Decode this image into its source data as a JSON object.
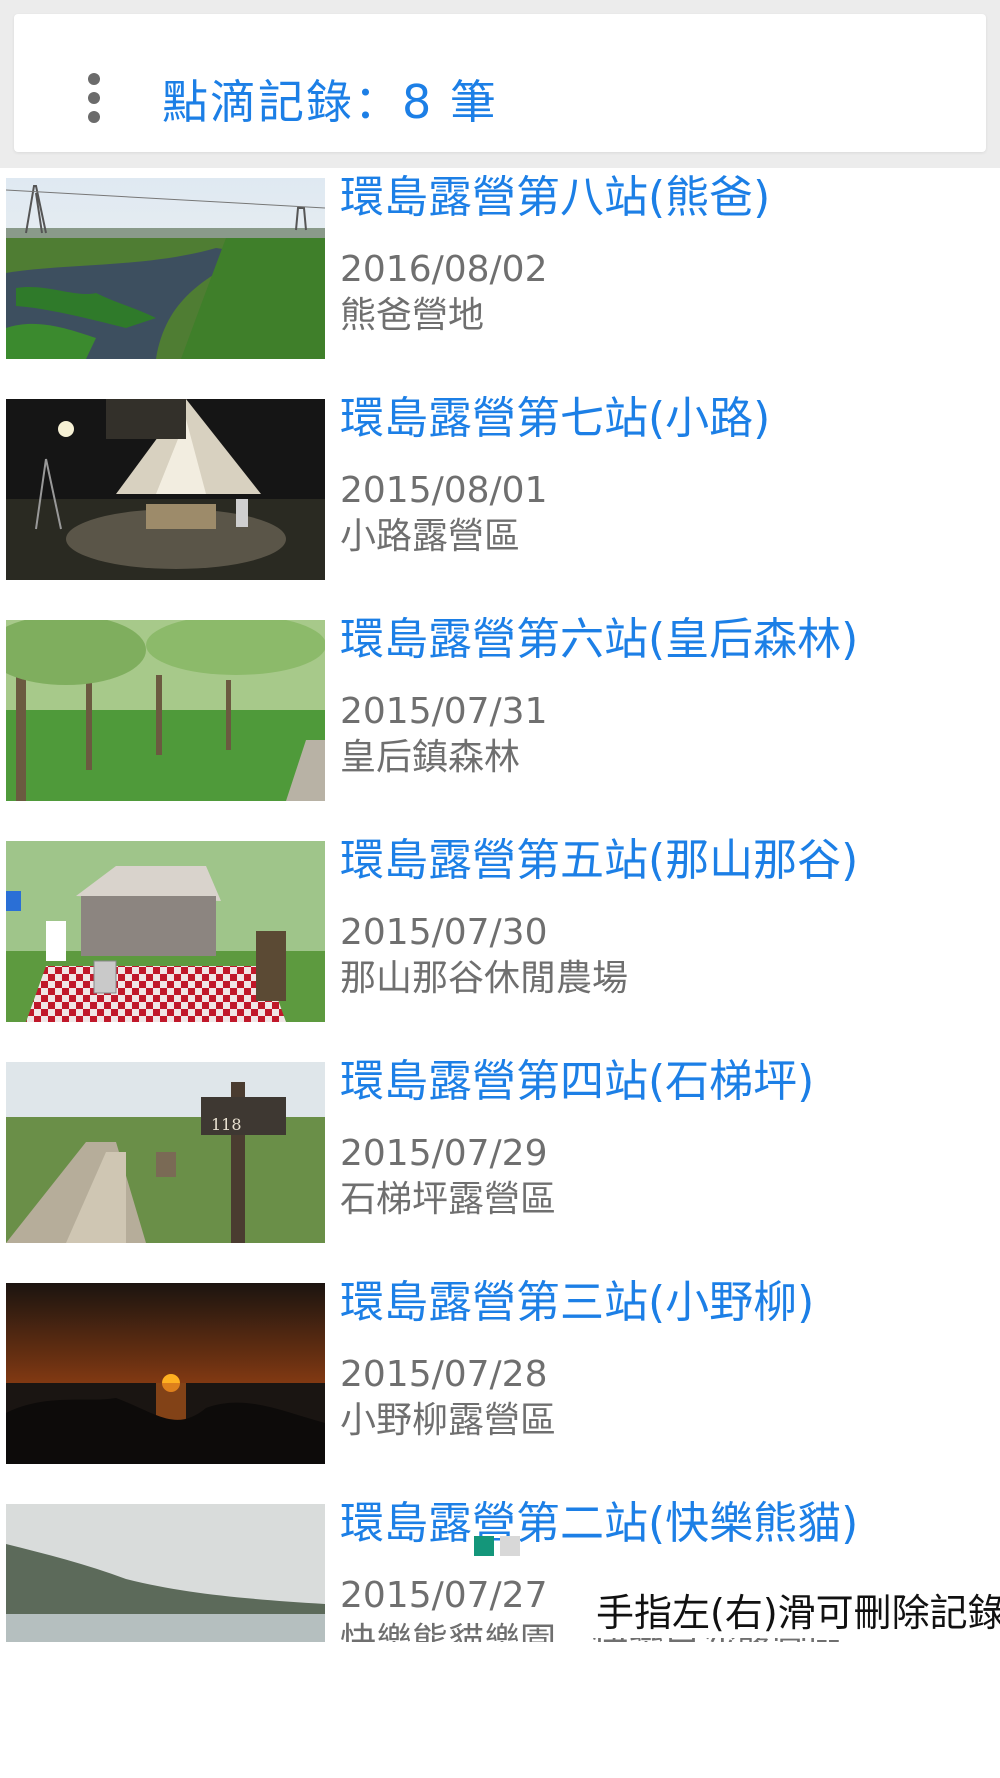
{
  "header": {
    "title": "點滴記錄：8 筆",
    "menu_icon": "more-vert-icon",
    "accent": "#1c7fe6"
  },
  "records": [
    {
      "title": "環島露營第八站(熊爸)",
      "date": "2016/08/02",
      "place": "熊爸營地"
    },
    {
      "title": "環島露營第七站(小路)",
      "date": "2015/08/01",
      "place": "小路露營區"
    },
    {
      "title": "環島露營第六站(皇后森林)",
      "date": "2015/07/31",
      "place": "皇后鎮森林"
    },
    {
      "title": "環島露營第五站(那山那谷)",
      "date": "2015/07/30",
      "place": "那山那谷休閒農場"
    },
    {
      "title": "環島露營第四站(石梯坪)",
      "date": "2015/07/29",
      "place": "石梯坪露營區"
    },
    {
      "title": "環島露營第三站(小野柳)",
      "date": "2015/07/28",
      "place": "小野柳露營區"
    },
    {
      "title": "環島露營第二站(快樂熊貓)",
      "date": "2015/07/27",
      "place": "快樂熊貓樂園　快樂白沙露營區"
    }
  ],
  "hint": "手指左(右)滑可刪除記錄"
}
